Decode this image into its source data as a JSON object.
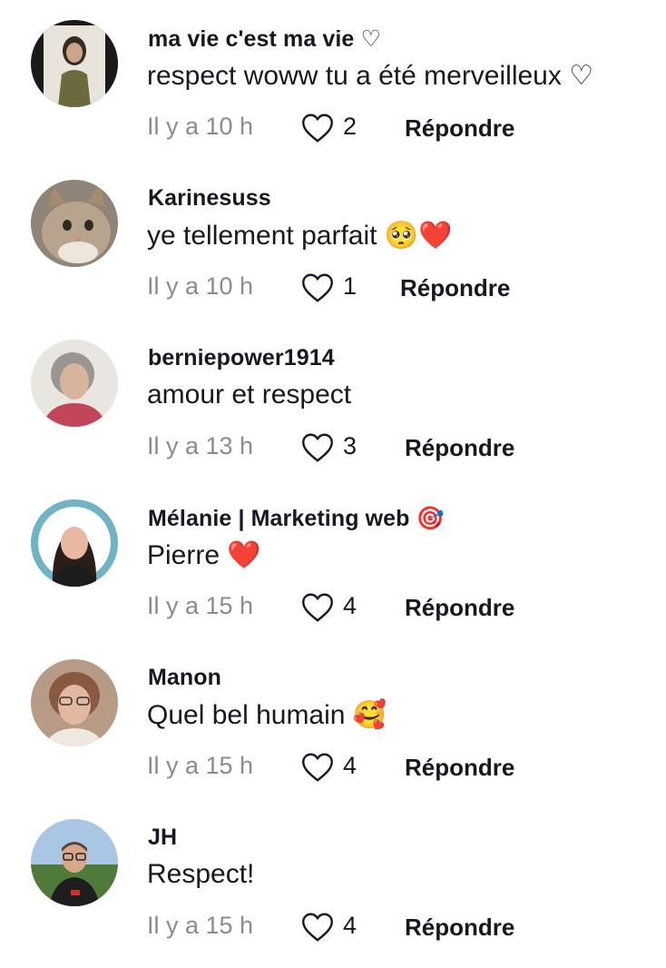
{
  "comments": [
    {
      "username": "ma vie c'est ma vie ♡",
      "text": "respect woww tu a été merveilleux ♡",
      "time": "Il y a 10 h",
      "likes": "2",
      "reply_label": "Répondre"
    },
    {
      "username": "Karinesuss",
      "text": "ye tellement parfait",
      "text_emoji": "🥺❤️",
      "time": "Il y a 10 h",
      "likes": "1",
      "reply_label": "Répondre"
    },
    {
      "username": "berniepower1914",
      "text": "amour et respect",
      "time": "Il y a 13 h",
      "likes": "3",
      "reply_label": "Répondre"
    },
    {
      "username": "Mélanie | Marketing web",
      "username_emoji": "🎯",
      "text": "Pierre",
      "text_emoji": "❤️",
      "time": "Il y a 15 h",
      "likes": "4",
      "reply_label": "Répondre"
    },
    {
      "username": "Manon",
      "text": "Quel bel humain",
      "text_emoji": "🥰",
      "time": "Il y a 15 h",
      "likes": "4",
      "reply_label": "Répondre"
    },
    {
      "username": "JH",
      "text": "Respect!",
      "time": "Il y a 15 h",
      "likes": "4",
      "reply_label": "Répondre"
    }
  ],
  "icons": {
    "like": "heart-outline-icon"
  },
  "colors": {
    "text": "#161823",
    "muted": "#8a8b91",
    "heart_emoji": "#e3262f"
  }
}
